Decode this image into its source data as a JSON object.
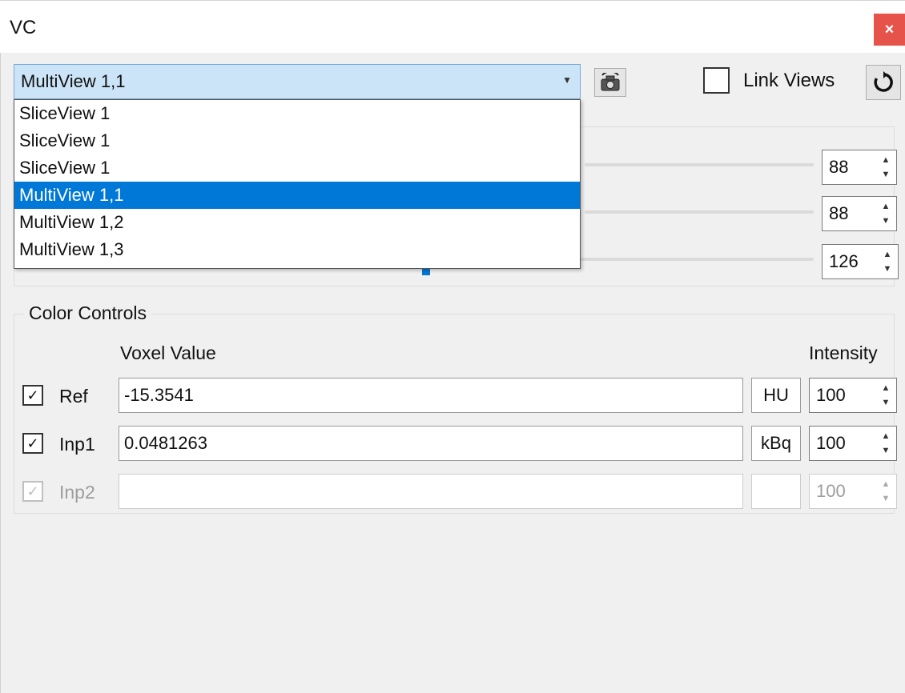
{
  "window": {
    "title": "VC",
    "close_glyph": "×"
  },
  "view_selector": {
    "selected": "MultiView 1,1",
    "options": [
      "SliceView 1",
      "SliceView 1",
      "SliceView 1",
      "MultiView 1,1",
      "MultiView 1,2",
      "MultiView 1,3"
    ],
    "selected_index": 3
  },
  "link_views": {
    "label": "Link Views",
    "checked": false
  },
  "sliders": [
    {
      "value": "88"
    },
    {
      "value": "88"
    },
    {
      "value": "126"
    }
  ],
  "color_controls": {
    "title": "Color Controls",
    "voxel_header": "Voxel Value",
    "intensity_header": "Intensity",
    "rows": [
      {
        "label": "Ref",
        "checked": true,
        "value": "-15.3541",
        "unit": "HU",
        "intensity": "100",
        "enabled": true
      },
      {
        "label": "Inp1",
        "checked": true,
        "value": "0.0481263",
        "unit": "kBq",
        "intensity": "100",
        "enabled": true
      },
      {
        "label": "Inp2",
        "checked": true,
        "value": "",
        "unit": "",
        "intensity": "100",
        "enabled": false
      }
    ]
  },
  "icons": {
    "close": "close-icon",
    "reset_view": "camera-reset-icon",
    "refresh": "refresh-icon",
    "spin_up": "▲",
    "spin_down": "▼",
    "check": "✓"
  },
  "colors": {
    "selection": "#0078d7",
    "close": "#e5534b",
    "combo_bg": "#cce4f7"
  }
}
